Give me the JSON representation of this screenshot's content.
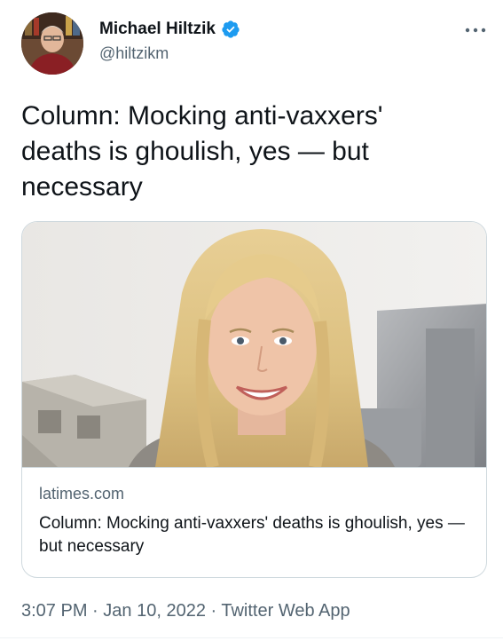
{
  "author": {
    "display_name": "Michael Hiltzik",
    "handle": "@hiltzikm",
    "verified": true,
    "verified_color": "#1d9bf0"
  },
  "tweet": {
    "text": "Column: Mocking anti-vaxxers' deaths is ghoulish, yes — but necessary"
  },
  "card": {
    "domain": "latimes.com",
    "title": "Column: Mocking anti-vaxxers' deaths is ghoulish, yes — but necessary",
    "image_subject": "smiling woman with long blonde hair"
  },
  "meta": {
    "time": "3:07 PM",
    "separator": "·",
    "date": "Jan 10, 2022",
    "source": "Twitter Web App"
  },
  "icons": {
    "more": "more-horizontal-icon",
    "verified": "verified-badge-icon"
  },
  "colors": {
    "text_primary": "#0f1419",
    "text_secondary": "#536471",
    "border": "#cfd9de"
  }
}
